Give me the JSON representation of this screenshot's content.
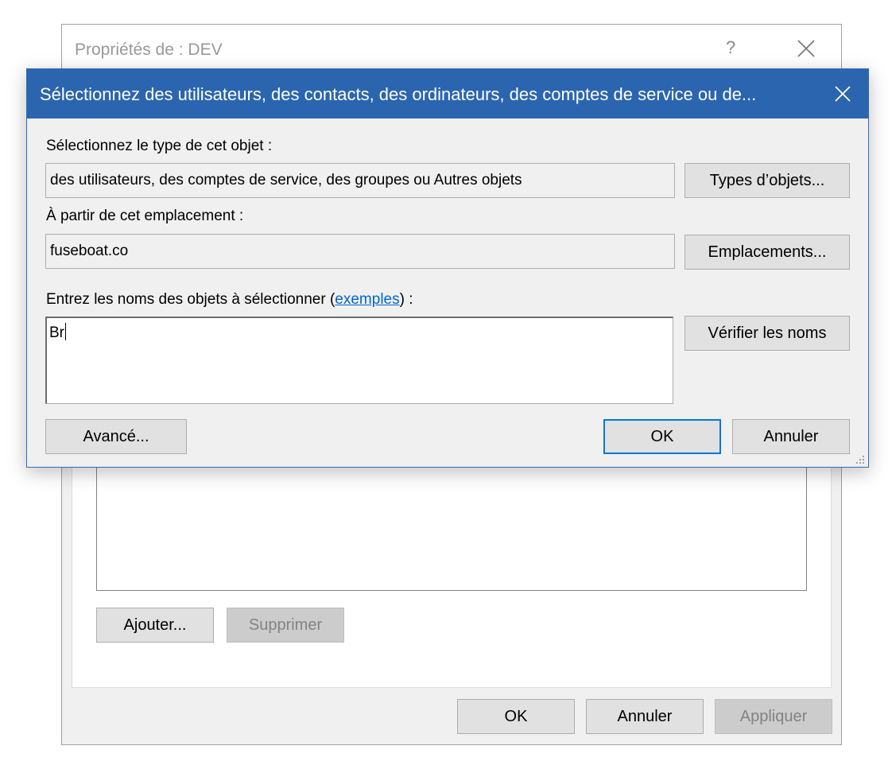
{
  "background_window": {
    "title": "Propriétés de : DEV",
    "help_glyph": "?",
    "buttons": {
      "add": "Ajouter...",
      "remove": "Supprimer",
      "ok": "OK",
      "cancel": "Annuler",
      "apply": "Appliquer"
    }
  },
  "dialog": {
    "title": "Sélectionnez des utilisateurs, des contacts, des ordinateurs, des comptes de service ou de...",
    "object_type_label": "Sélectionnez le type de cet objet :",
    "object_type_value": "des utilisateurs, des comptes de service, des groupes ou Autres objets",
    "object_types_button": "Types d’objets...",
    "location_label": "À partir de cet emplacement :",
    "location_value": "fuseboat.co",
    "locations_button": "Emplacements...",
    "names_label_prefix": "Entrez les noms des objets à sélectionner (",
    "names_label_link": "exemples",
    "names_label_suffix": ") :",
    "names_value": "Br",
    "check_names_button": "Vérifier les noms",
    "advanced_button": "Avancé...",
    "ok_button": "OK",
    "cancel_button": "Annuler"
  },
  "colors": {
    "titlebar": "#2b65b0",
    "focus_border": "#0078d7",
    "link": "#0066cc"
  }
}
